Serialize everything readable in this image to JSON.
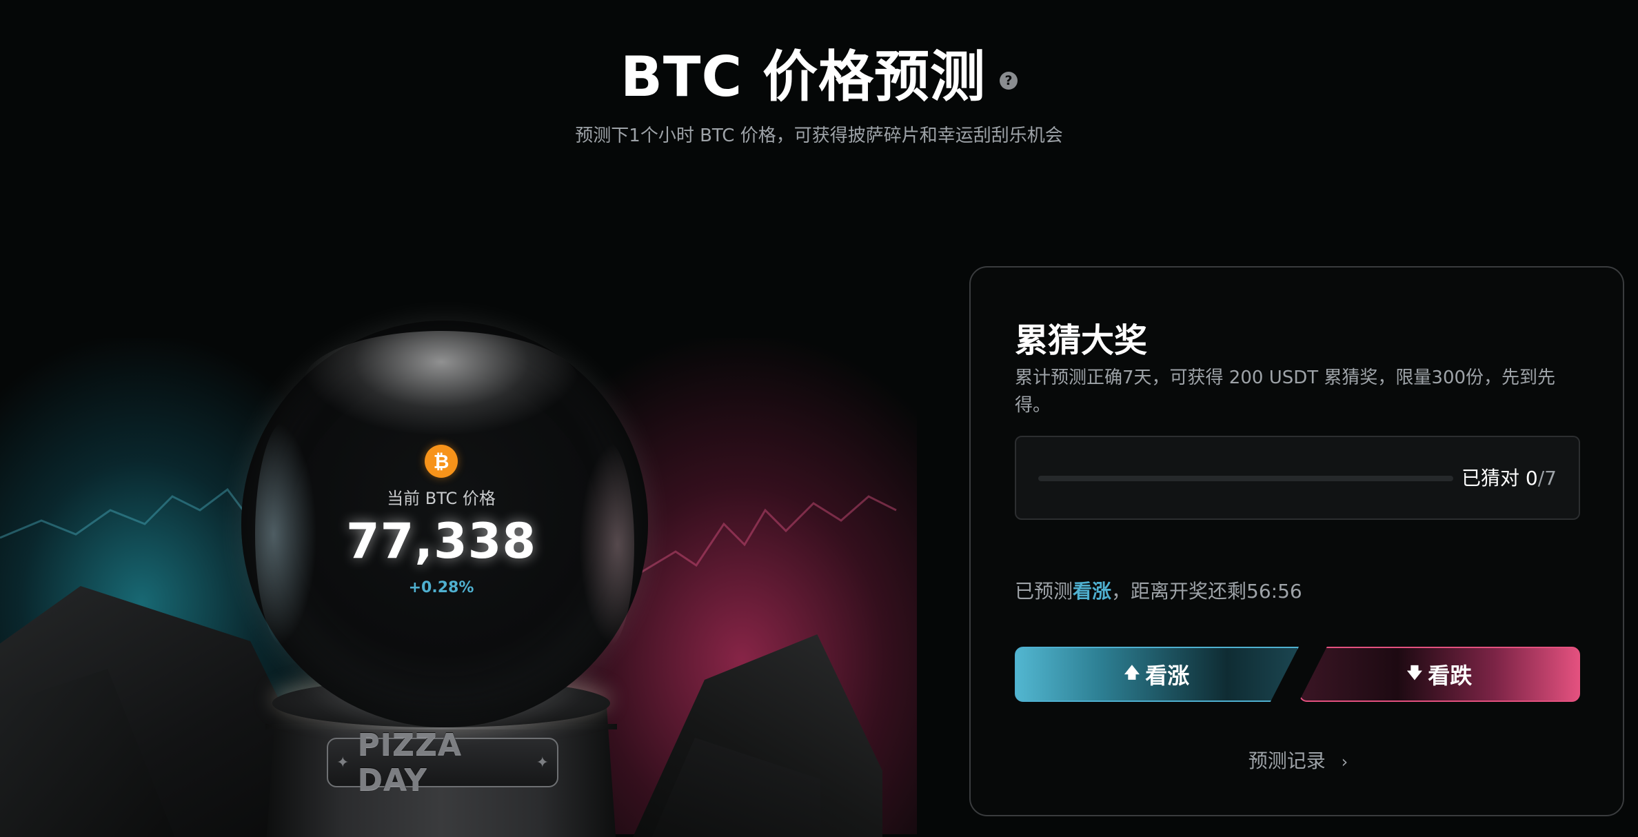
{
  "header": {
    "title": "BTC 价格预测",
    "help_icon": "?",
    "subtitle": "预测下1个小时 BTC 价格，可获得披萨碎片和幸运刮刮乐机会"
  },
  "hero": {
    "coin_icon": "₿",
    "price_label": "当前 BTC 价格",
    "price_value": "77,338",
    "price_change": "+0.28%",
    "stand_label": "PIZZA DAY",
    "stand_star": "✦"
  },
  "prize_card": {
    "title": "累猜大奖",
    "description": "累计预测正确7天，可获得 200 USDT 累猜奖，限量300份，先到先得。",
    "progress": {
      "label": "已猜对 ",
      "current": "0",
      "total": "/7",
      "fraction": 0
    },
    "status": {
      "prefix": "已预测",
      "prediction": "看涨",
      "suffix": "，距离开奖还剩56:56"
    },
    "buttons": {
      "up_label": "看涨",
      "up_icon": "🡅",
      "down_label": "看跌",
      "down_icon": "🡇"
    },
    "history_label": "预测记录",
    "history_icon": "›"
  },
  "colors": {
    "up": "#4fb0d0",
    "down": "#e3517f",
    "bitcoin": "#f7931a"
  }
}
